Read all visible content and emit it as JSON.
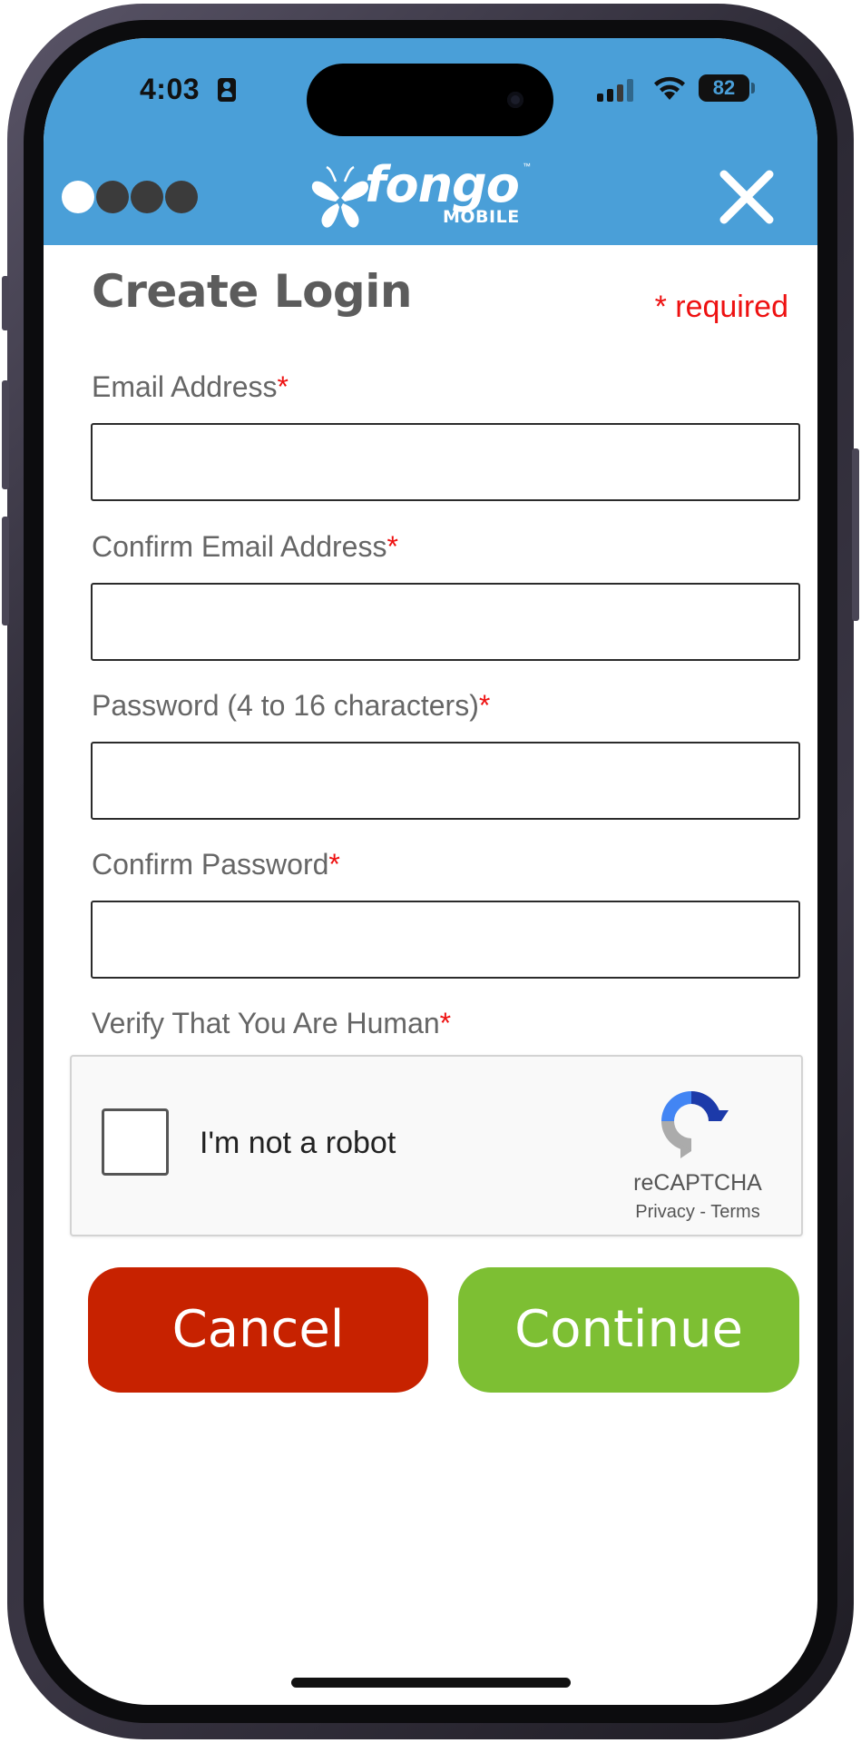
{
  "status_bar": {
    "time": "4:03",
    "battery": "82"
  },
  "header": {
    "brand": "fongo",
    "brand_sub": "MOBILE",
    "brand_tm": "™",
    "progress_steps_total": 4,
    "progress_step_current": 1,
    "background_color": "#4a9fd8"
  },
  "form": {
    "title": "Create Login",
    "required_note": "* required",
    "required_marker": "*",
    "fields": [
      {
        "label": "Email Address",
        "value": ""
      },
      {
        "label": "Confirm Email Address",
        "value": ""
      },
      {
        "label": "Password (4 to 16 characters)",
        "value": ""
      },
      {
        "label": "Confirm Password",
        "value": ""
      }
    ],
    "captcha_label": "Verify That You Are Human"
  },
  "captcha": {
    "checkbox_label": "I'm not a robot",
    "checked": false,
    "brand": "reCAPTCHA",
    "privacy": "Privacy",
    "separator": " - ",
    "terms": "Terms"
  },
  "buttons": {
    "cancel": "Cancel",
    "continue": "Continue",
    "cancel_color": "#c72200",
    "continue_color": "#7dbf33"
  },
  "icons": {
    "close": "close-icon",
    "signal": "cellular-signal-icon",
    "wifi": "wifi-icon",
    "battery": "battery-icon",
    "person": "focus-person-icon",
    "captcha": "recaptcha-logo-icon"
  }
}
